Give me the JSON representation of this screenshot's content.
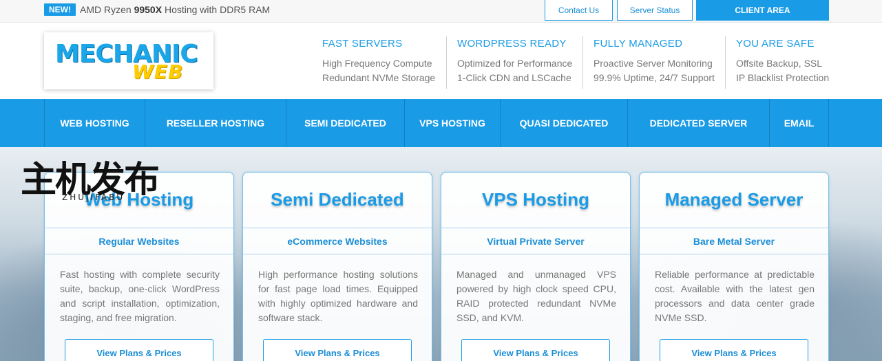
{
  "topbar": {
    "badge": "NEW!",
    "announcement_pre": "AMD Ryzen ",
    "announcement_bold": "9950X",
    "announcement_post": " Hosting with DDR5 RAM",
    "contact_label": "Contact Us",
    "status_label": "Server Status",
    "client_label": "CLIENT AREA"
  },
  "logo": {
    "line1": "MECHANIC",
    "line2": "WEB"
  },
  "features": [
    {
      "title": "FAST SERVERS",
      "line1": "High Frequency Compute",
      "line2": "Redundant NVMe Storage"
    },
    {
      "title": "WORDPRESS READY",
      "line1": "Optimized for Performance",
      "line2": "1-Click CDN and LSCache"
    },
    {
      "title": "FULLY MANAGED",
      "line1": "Proactive Server Monitoring",
      "line2": "99.9% Uptime, 24/7 Support"
    },
    {
      "title": "YOU ARE SAFE",
      "line1": "Offsite Backup, SSL",
      "line2": "IP Blacklist Protection"
    }
  ],
  "nav": [
    {
      "label": "WEB HOSTING"
    },
    {
      "label": "RESELLER HOSTING"
    },
    {
      "label": "SEMI DEDICATED"
    },
    {
      "label": "VPS HOSTING"
    },
    {
      "label": "QUASI DEDICATED"
    },
    {
      "label": "DEDICATED SERVER"
    },
    {
      "label": "EMAIL"
    }
  ],
  "cards": [
    {
      "title": "Web Hosting",
      "subtitle": "Regular Websites",
      "description": "Fast hosting with complete security suite, backup, one-click WordPress and script installation, optimization, staging, and free migration.",
      "button": "View Plans & Prices"
    },
    {
      "title": "Semi Dedicated",
      "subtitle": "eCommerce Websites",
      "description": "High performance hosting solutions for fast page load times. Equipped with highly optimized hardware and software stack.",
      "button": "View Plans & Prices"
    },
    {
      "title": "VPS Hosting",
      "subtitle": "Virtual Private Server",
      "description": "Managed and unmanaged VPS powered by high clock speed CPU, RAID protected redundant NVMe SSD, and KVM.",
      "button": "View Plans & Prices"
    },
    {
      "title": "Managed Server",
      "subtitle": "Bare Metal Server",
      "description": "Reliable performance at predictable cost. Available with the latest gen processors and data center grade NVMe SSD.",
      "button": "View Plans & Prices"
    }
  ],
  "watermark": {
    "chinese": "主机发布",
    "latin": "ZHUJIFABU"
  },
  "colors": {
    "brand_blue": "#1a9be6",
    "logo_yellow": "#ffcc00"
  }
}
